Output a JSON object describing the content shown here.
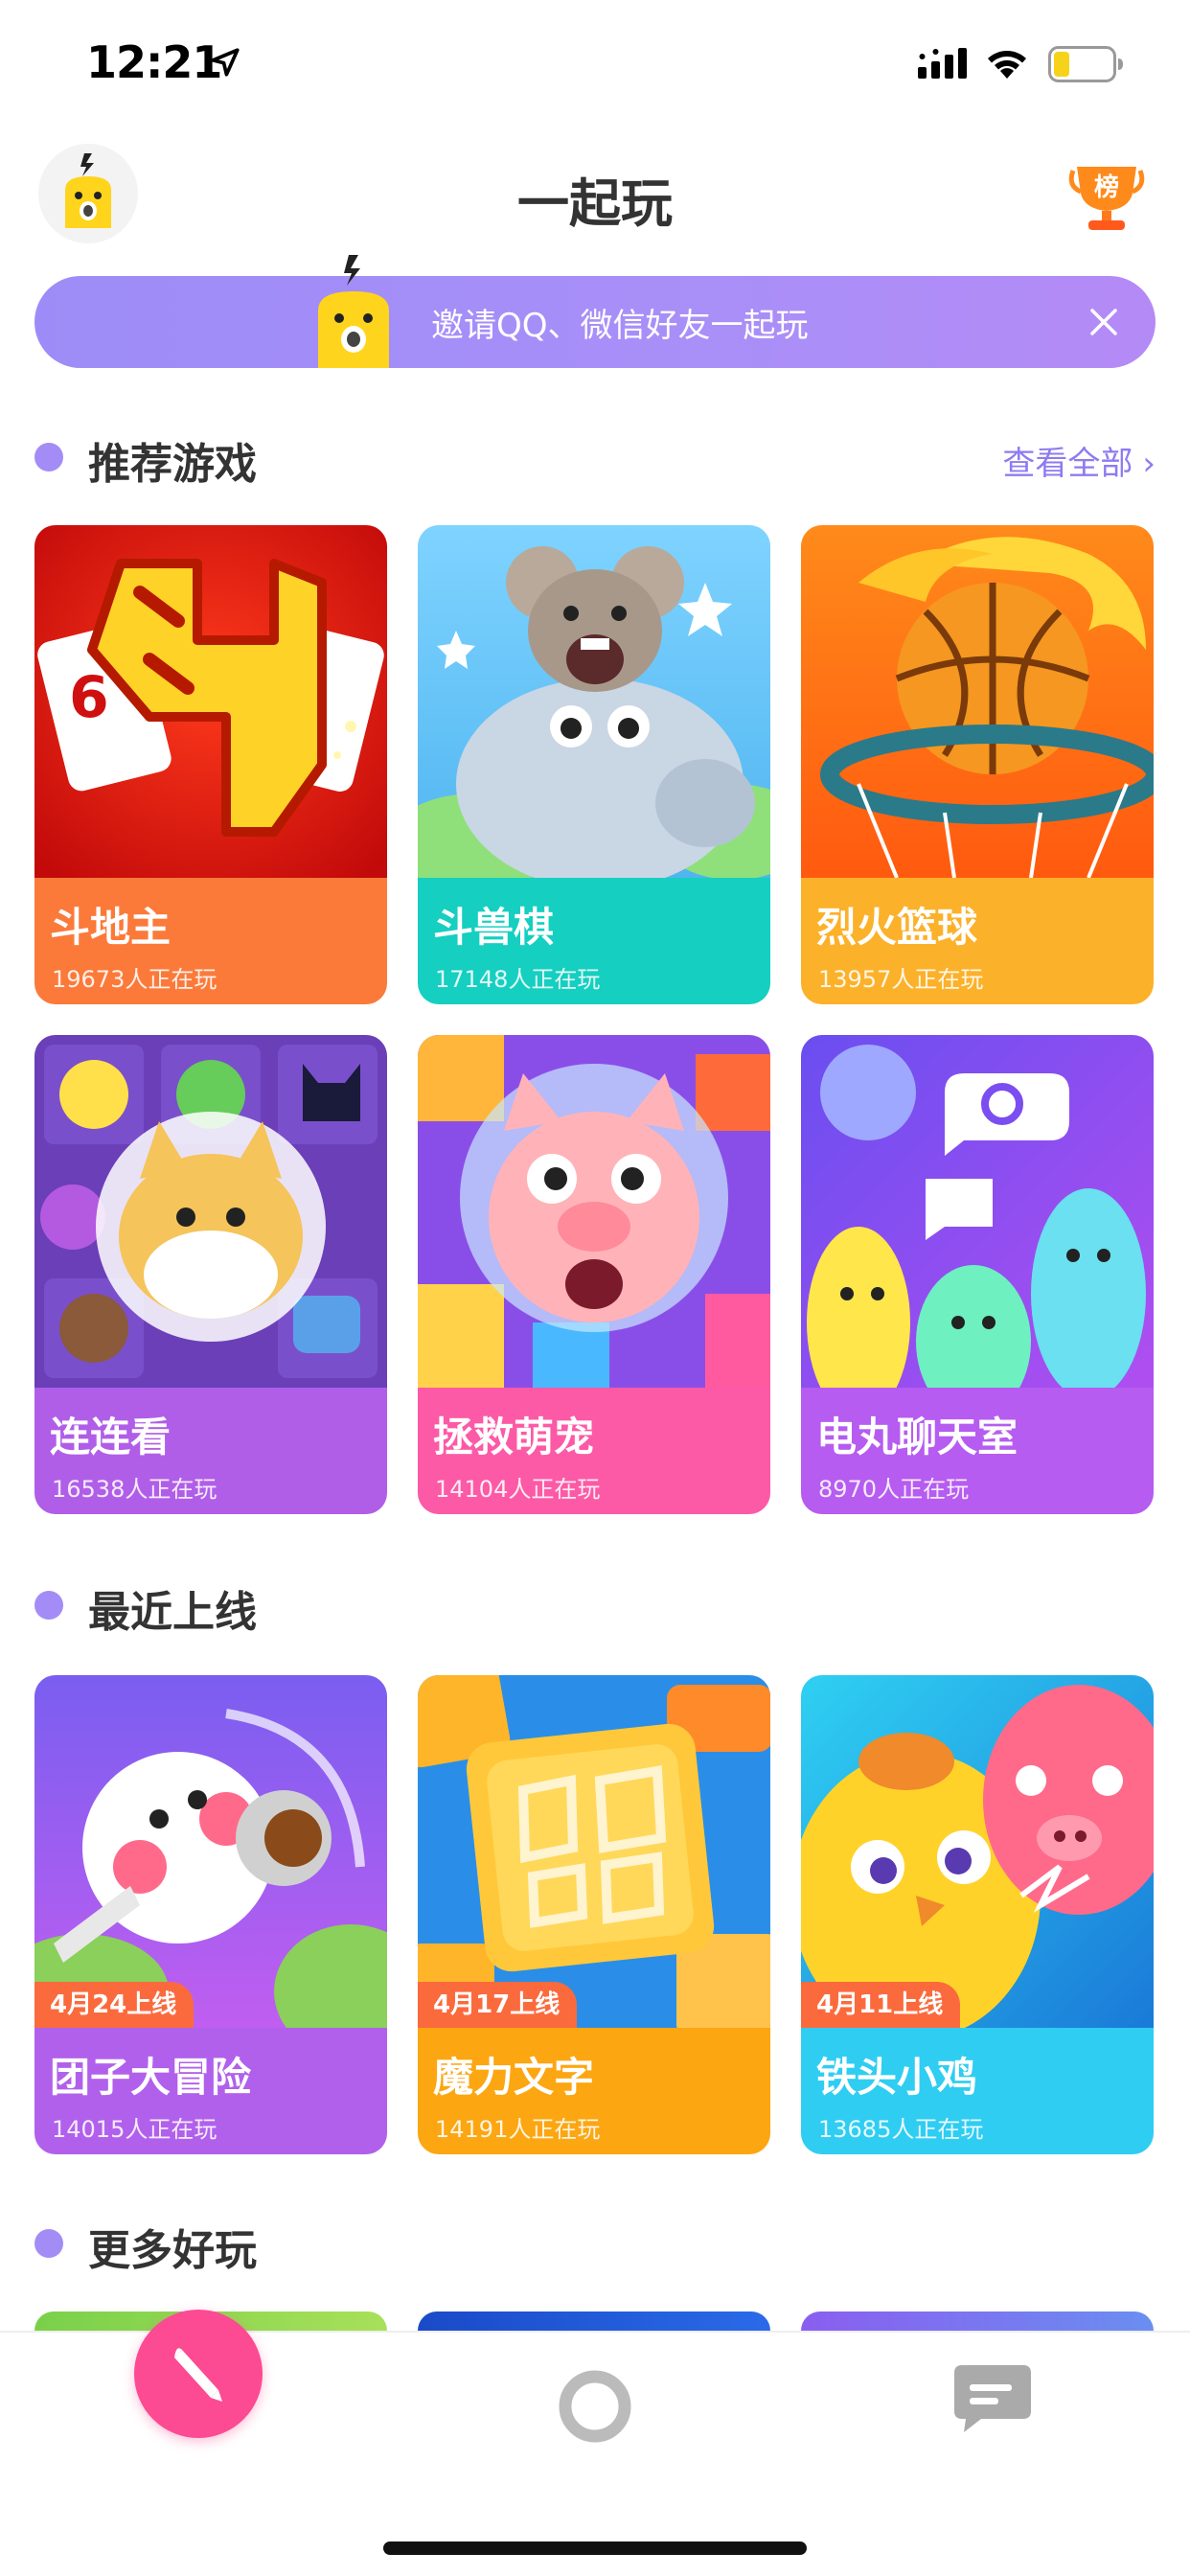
{
  "status_bar": {
    "time": "12:21"
  },
  "header": {
    "title": "一起玩",
    "rank_badge": "榜"
  },
  "invite_banner": {
    "text": "邀请QQ、微信好友一起玩"
  },
  "sections": {
    "recommended": {
      "title": "推荐游戏",
      "more_label": "查看全部",
      "more_chevron": "›"
    },
    "recent": {
      "title": "最近上线"
    },
    "more_fun": {
      "title": "更多好玩"
    }
  },
  "recommended_games": [
    {
      "name": "斗地主",
      "players": "19673人正在玩",
      "color": "#fb7a3a"
    },
    {
      "name": "斗兽棋",
      "players": "17148人正在玩",
      "color": "#15cfc0"
    },
    {
      "name": "烈火篮球",
      "players": "13957人正在玩",
      "color": "#fcb12a"
    },
    {
      "name": "连连看",
      "players": "16538人正在玩",
      "color": "#b05ee8"
    },
    {
      "name": "拯救萌宠",
      "players": "14104人正在玩",
      "color": "#fc5aa6"
    },
    {
      "name": "电丸聊天室",
      "players": "8970人正在玩",
      "color": "#b65cf0"
    }
  ],
  "recent_games": [
    {
      "name": "团子大冒险",
      "players": "14015人正在玩",
      "release": "4月24上线",
      "color": "#b160ec"
    },
    {
      "name": "魔力文字",
      "players": "14191人正在玩",
      "release": "4月17上线",
      "color": "#fca612"
    },
    {
      "name": "铁头小鸡",
      "players": "13685人正在玩",
      "release": "4月11上线",
      "color": "#2fcdf2"
    }
  ],
  "tab_bar": {
    "icons": [
      "compass-icon",
      "circle-icon",
      "chat-icon"
    ],
    "active": "compass-icon",
    "active_color": "#fc4a93"
  },
  "colors": {
    "accent": "#a48cf7",
    "banner": "#a08ef7",
    "tag": "#fb6a3d"
  }
}
